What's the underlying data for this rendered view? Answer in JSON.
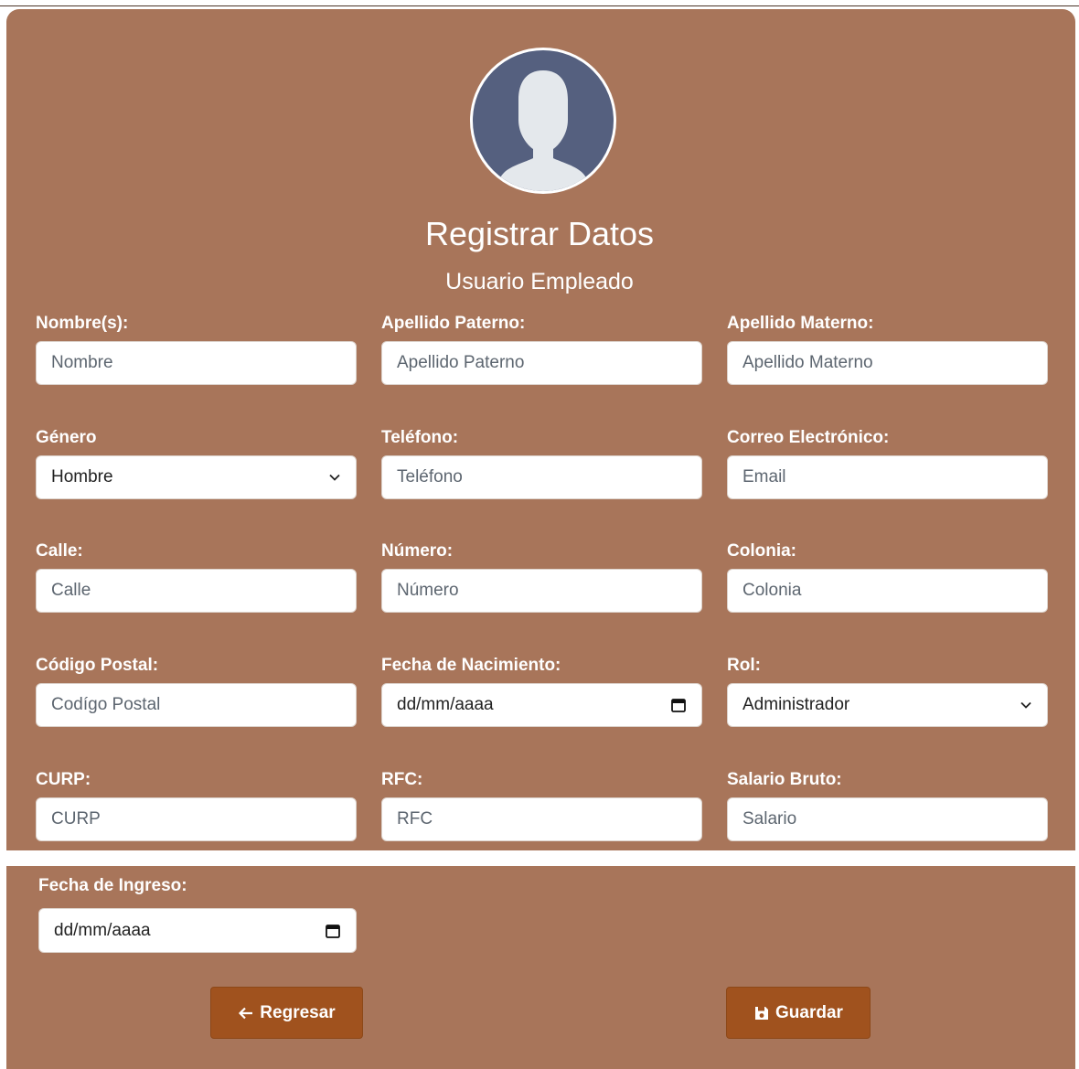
{
  "header": {
    "title": "Registrar Datos",
    "subtitle": "Usuario Empleado"
  },
  "form": {
    "nombre": {
      "label": "Nombre(s):",
      "placeholder": "Nombre"
    },
    "apellido_paterno": {
      "label": "Apellido Paterno:",
      "placeholder": "Apellido Paterno"
    },
    "apellido_materno": {
      "label": "Apellido Materno:",
      "placeholder": "Apellido Materno"
    },
    "genero": {
      "label": "Género",
      "value": "Hombre"
    },
    "telefono": {
      "label": "Teléfono:",
      "placeholder": "Teléfono"
    },
    "correo": {
      "label": "Correo Electrónico:",
      "placeholder": "Email"
    },
    "calle": {
      "label": "Calle:",
      "placeholder": "Calle"
    },
    "numero": {
      "label": "Número:",
      "placeholder": "Número"
    },
    "colonia": {
      "label": "Colonia:",
      "placeholder": "Colonia"
    },
    "codigo_postal": {
      "label": "Código Postal:",
      "placeholder": "Codígo Postal"
    },
    "fecha_nacimiento": {
      "label": "Fecha de Nacimiento:",
      "value": "dd/mm/aaaa"
    },
    "rol": {
      "label": "Rol:",
      "value": "Administrador"
    },
    "curp": {
      "label": "CURP:",
      "placeholder": "CURP"
    },
    "rfc": {
      "label": "RFC:",
      "placeholder": "RFC"
    },
    "salario": {
      "label": "Salario Bruto:",
      "placeholder": "Salario"
    },
    "fecha_ingreso": {
      "label": "Fecha de Ingreso:",
      "value": "dd/mm/aaaa"
    }
  },
  "buttons": {
    "back_label": "Regresar",
    "save_label": "Guardar"
  },
  "colors": {
    "panel": "#a8755a",
    "button": "#a0521e",
    "avatar_bg": "#55607f"
  },
  "icons": {
    "back": "arrow-left-icon",
    "save": "floppy-disk-icon",
    "select": "chevron-down-icon",
    "date": "calendar-icon",
    "avatar": "user-silhouette-icon"
  }
}
